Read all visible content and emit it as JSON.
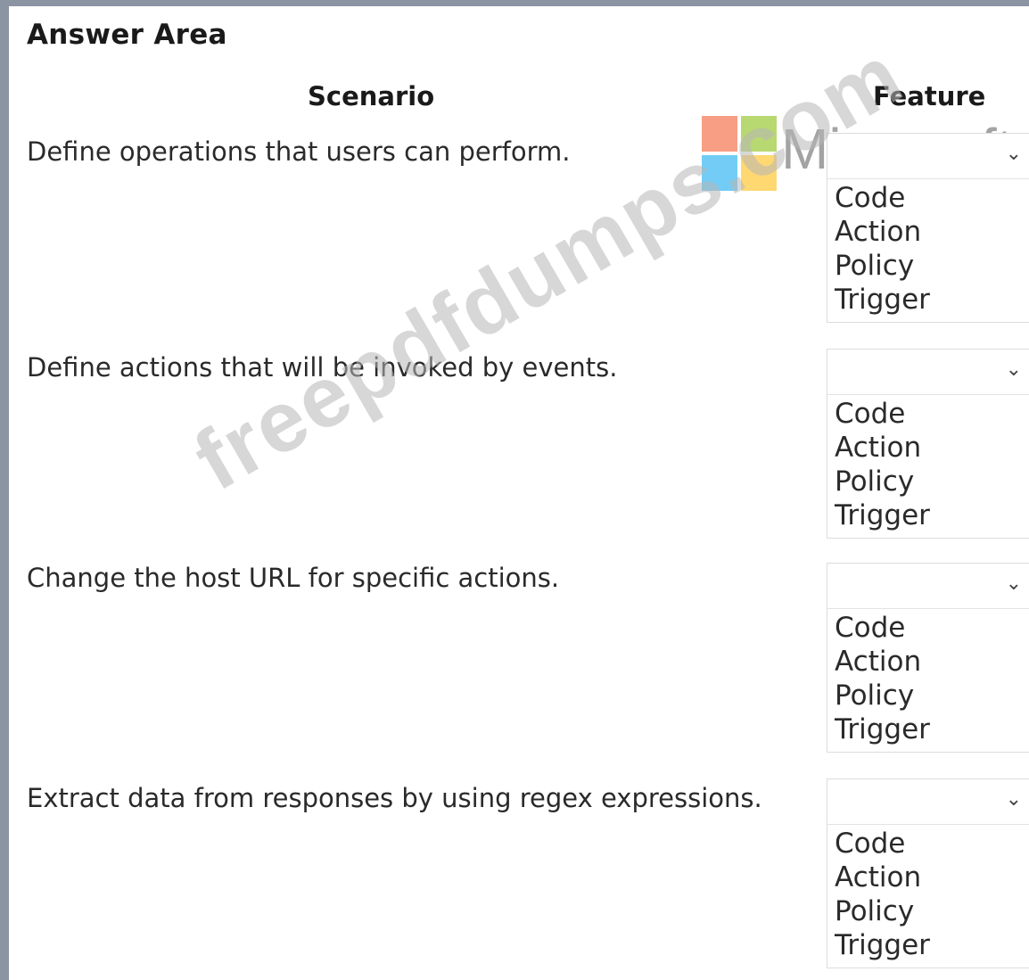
{
  "title": "Answer Area",
  "headers": {
    "scenario": "Scenario",
    "feature": "Feature"
  },
  "rows": [
    {
      "scenario": "Define operations that users can perform.",
      "options": [
        "Code",
        "Action",
        "Policy",
        "Trigger"
      ]
    },
    {
      "scenario": "Define actions that will be invoked by events.",
      "options": [
        "Code",
        "Action",
        "Policy",
        "Trigger"
      ]
    },
    {
      "scenario": "Change the host URL for specific actions.",
      "options": [
        "Code",
        "Action",
        "Policy",
        "Trigger"
      ]
    },
    {
      "scenario": "Extract data from responses by using regex expressions.",
      "options": [
        "Code",
        "Action",
        "Policy",
        "Trigger"
      ]
    }
  ],
  "dropdown_chevron": "⌄",
  "watermarks": {
    "brand": "Microsoft",
    "site": "freepdfdumps.com"
  },
  "colors": {
    "frame": "#8a94a3",
    "ms_red": "#f25022",
    "ms_green": "#7fba00",
    "ms_blue": "#00a4ef",
    "ms_yellow": "#ffb900"
  }
}
